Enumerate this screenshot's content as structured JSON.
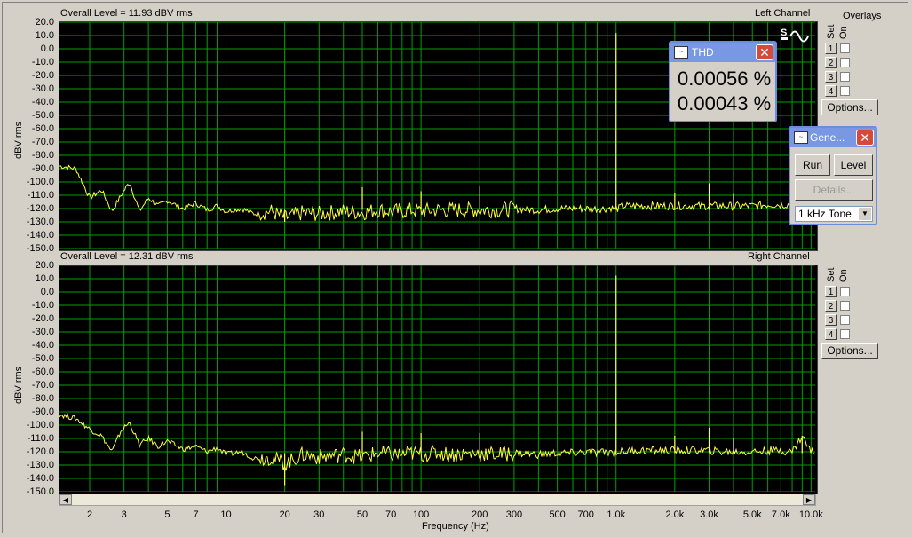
{
  "colors": {
    "trace": "#ffff40",
    "grid": "#00a000",
    "plot_bg": "#000000"
  },
  "top": {
    "overall_level": "Overall Level = 11.93 dBV rms",
    "channel": "Left Channel",
    "ylabel": "dBV rms"
  },
  "bottom": {
    "overall_level": "Overall Level = 12.31 dBV rms",
    "channel": "Right Channel",
    "ylabel": "dBV rms"
  },
  "y_ticks": [
    "20.0",
    "10.0",
    "0.0",
    "-10.0",
    "-20.0",
    "-30.0",
    "-40.0",
    "-50.0",
    "-60.0",
    "-70.0",
    "-80.0",
    "-90.0",
    "-100.0",
    "-110.0",
    "-120.0",
    "-130.0",
    "-140.0",
    "-150.0"
  ],
  "x_ticks": [
    "2",
    "3",
    "5",
    "7",
    "10",
    "20",
    "30",
    "50",
    "70",
    "100",
    "200",
    "300",
    "500",
    "700",
    "1.0k",
    "2.0k",
    "3.0k",
    "5.0k",
    "7.0k",
    "10.0k"
  ],
  "xlabel": "Frequency (Hz)",
  "overlays": {
    "title": "Overlays",
    "set_label": "Set",
    "on_label": "On",
    "slots": [
      "1",
      "2",
      "3",
      "4"
    ],
    "options_label": "Options..."
  },
  "thd_window": {
    "title": "THD",
    "values": [
      "0.00056 %",
      "0.00043 %"
    ]
  },
  "gen_window": {
    "title": "Gene...",
    "run_label": "Run",
    "level_label": "Level",
    "details_label": "Details...",
    "tone_select": "1 kHz Tone"
  },
  "chart_data": [
    {
      "type": "line",
      "title": "Left Channel",
      "xlabel": "Frequency (Hz)",
      "ylabel": "dBV rms",
      "xscale": "log",
      "xlim": [
        1.4,
        10500
      ],
      "ylim": [
        -150,
        20
      ],
      "grid": true,
      "series": [
        {
          "x": [
            1.4,
            1.7,
            2.0,
            2.3,
            2.6,
            2.9,
            3.2,
            3.6,
            4.0,
            4.5,
            5,
            6,
            7,
            8,
            9,
            10,
            12,
            14,
            17,
            20,
            25,
            30,
            40,
            50,
            60,
            70,
            80,
            90,
            100,
            120,
            150,
            200,
            250,
            300,
            400,
            500,
            600,
            700,
            800,
            900,
            950,
            1000,
            1050,
            1100,
            1200,
            1300,
            1500,
            1700,
            2000,
            2500,
            3000,
            3500,
            4000,
            5000,
            6000,
            7000,
            8000,
            9000,
            10000
          ],
          "y": [
            -88,
            -90,
            -112,
            -106,
            -122,
            -110,
            -100,
            -122,
            -112,
            -118,
            -114,
            -120,
            -116,
            -121,
            -118,
            -122,
            -120,
            -124,
            -122,
            -127,
            -123,
            -124,
            -122,
            -123,
            -121,
            -122,
            -122,
            -121,
            -122,
            -121,
            -121,
            -121,
            -121,
            -120,
            -121,
            -120,
            -120,
            -120,
            -120,
            -120,
            -119,
            11.9,
            -119,
            -118,
            -118,
            -118,
            -118,
            -118,
            -118,
            -118,
            -118,
            -118,
            -118,
            -118,
            -117,
            -117,
            -117,
            -117,
            -119
          ]
        }
      ],
      "peaks": [
        {
          "x": 20,
          "y": -130
        },
        {
          "x": 50,
          "y": -104
        },
        {
          "x": 100,
          "y": -107
        },
        {
          "x": 200,
          "y": -103
        },
        {
          "x": 1000,
          "y": 11.9
        },
        {
          "x": 2000,
          "y": -108
        },
        {
          "x": 3000,
          "y": -101
        },
        {
          "x": 4000,
          "y": -109
        }
      ]
    },
    {
      "type": "line",
      "title": "Right Channel",
      "xlabel": "Frequency (Hz)",
      "ylabel": "dBV rms",
      "xscale": "log",
      "xlim": [
        1.4,
        10500
      ],
      "ylim": [
        -150,
        20
      ],
      "grid": true,
      "series": [
        {
          "x": [
            1.4,
            1.7,
            2.0,
            2.3,
            2.6,
            2.9,
            3.2,
            3.6,
            4.0,
            4.5,
            5,
            6,
            7,
            8,
            9,
            10,
            12,
            14,
            17,
            20,
            25,
            30,
            40,
            50,
            60,
            70,
            80,
            90,
            100,
            120,
            150,
            200,
            250,
            300,
            400,
            500,
            600,
            700,
            800,
            900,
            950,
            1000,
            1050,
            1100,
            1200,
            1300,
            1500,
            1700,
            2000,
            2500,
            3000,
            3500,
            4000,
            5000,
            6000,
            7000,
            8000,
            9000,
            10000
          ],
          "y": [
            -92,
            -95,
            -103,
            -108,
            -120,
            -104,
            -98,
            -115,
            -110,
            -116,
            -112,
            -118,
            -116,
            -120,
            -117,
            -122,
            -120,
            -125,
            -124,
            -129,
            -122,
            -124,
            -122,
            -124,
            -121,
            -122,
            -122,
            -121,
            -122,
            -121,
            -122,
            -121,
            -122,
            -121,
            -122,
            -121,
            -121,
            -120,
            -121,
            -120,
            -120,
            12.3,
            -120,
            -120,
            -119,
            -119,
            -119,
            -119,
            -119,
            -119,
            -119,
            -120,
            -120,
            -120,
            -119,
            -119,
            -120,
            -108,
            -120
          ]
        }
      ],
      "peaks": [
        {
          "x": 20,
          "y": -145
        },
        {
          "x": 50,
          "y": -105
        },
        {
          "x": 100,
          "y": -106
        },
        {
          "x": 200,
          "y": -106
        },
        {
          "x": 1000,
          "y": 12.3
        },
        {
          "x": 2000,
          "y": -108
        },
        {
          "x": 3000,
          "y": -102
        },
        {
          "x": 4000,
          "y": -110
        },
        {
          "x": 9000,
          "y": -108
        }
      ]
    }
  ]
}
